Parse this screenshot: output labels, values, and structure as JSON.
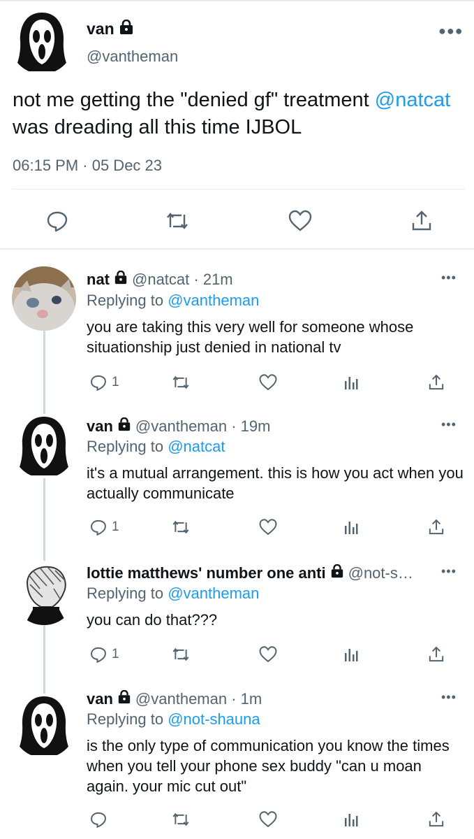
{
  "main_tweet": {
    "display_name": "van",
    "handle": "@vantheman",
    "text_prefix": "not me getting the \"denied gf\" treatment ",
    "mention": "@natcat",
    "text_suffix": " was dreading all this time IJBOL",
    "timestamp": "06:15 PM · 05 Dec 23",
    "more_icon": "more-icon",
    "actions": [
      "reply-icon",
      "retweet-icon",
      "like-icon",
      "share-icon"
    ]
  },
  "replies": [
    {
      "display_name": "nat",
      "handle": "@natcat",
      "age": "21m",
      "replying_label": "Replying to",
      "replying_to": "@vantheman",
      "text": "you are taking this very well for someone whose situationship just denied in national tv",
      "reply_count": "1",
      "avatar": "cat-avatar"
    },
    {
      "display_name": "van",
      "handle": "@vantheman",
      "age": "19m",
      "replying_label": "Replying to",
      "replying_to": "@natcat",
      "text": "it's a mutual arrangement. this is how you act when you actually communicate",
      "reply_count": "1",
      "avatar": "ghostface-avatar"
    },
    {
      "display_name": "lottie matthews' number one anti",
      "handle": "@not-s…",
      "age": "",
      "replying_label": "Replying to",
      "replying_to": "@vantheman",
      "text": "you can do that???",
      "reply_count": "1",
      "avatar": "sketch-avatar"
    },
    {
      "display_name": "van",
      "handle": "@vantheman",
      "age": "1m",
      "replying_label": "Replying to",
      "replying_to": "@not-shauna",
      "text": "is the only type of communication you know the times when you tell your phone sex buddy \"can u moan again. your mic cut out\"",
      "reply_count": "",
      "avatar": "ghostface-avatar"
    }
  ],
  "colors": {
    "link": "#1d9bf0",
    "secondary_text": "#536471",
    "divider": "#e6ecf0",
    "thread_line": "#cfd9de"
  }
}
